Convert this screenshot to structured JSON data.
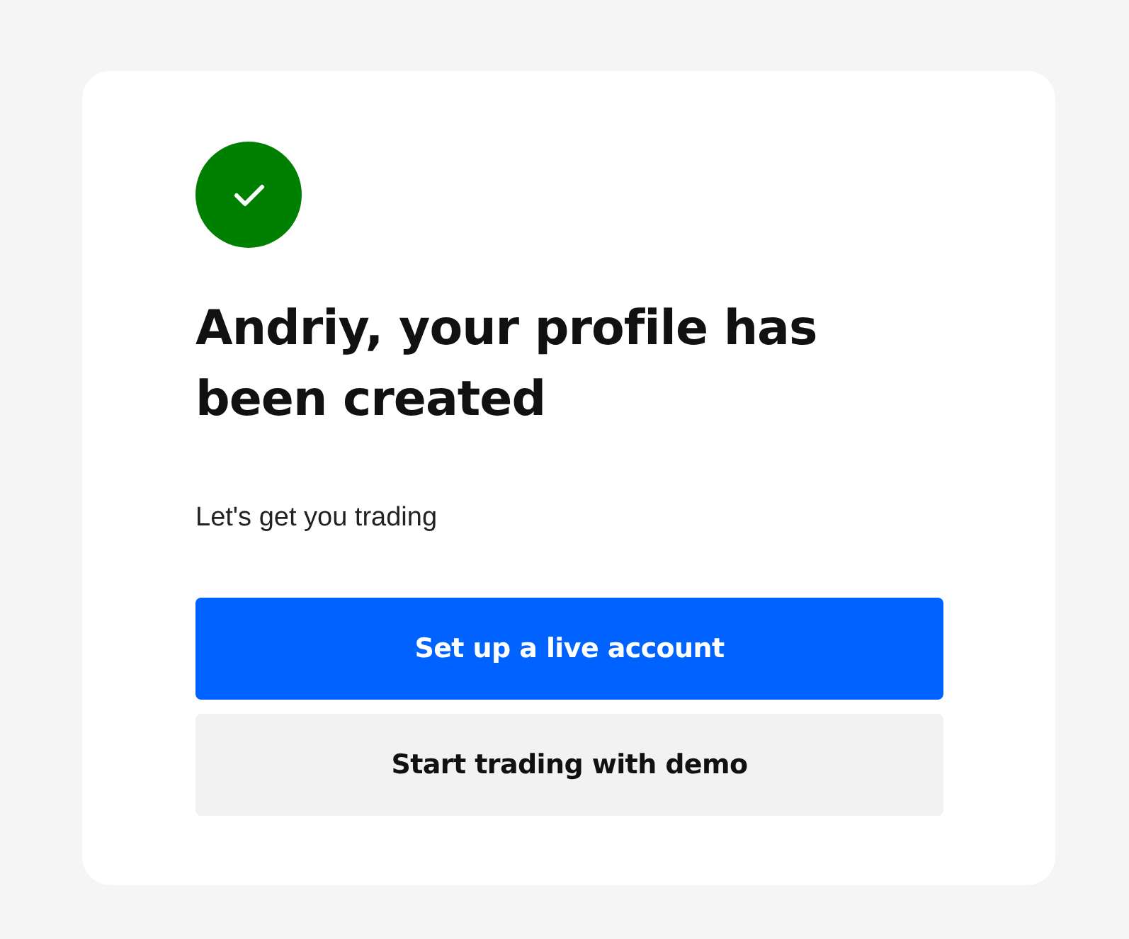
{
  "title": "Andriy, your profile has been created",
  "subtitle": "Let's get you trading",
  "buttons": [
    {
      "label": "Set up a live account",
      "kind": "primary"
    },
    {
      "label": "Start trading with demo",
      "kind": "secondary"
    }
  ]
}
